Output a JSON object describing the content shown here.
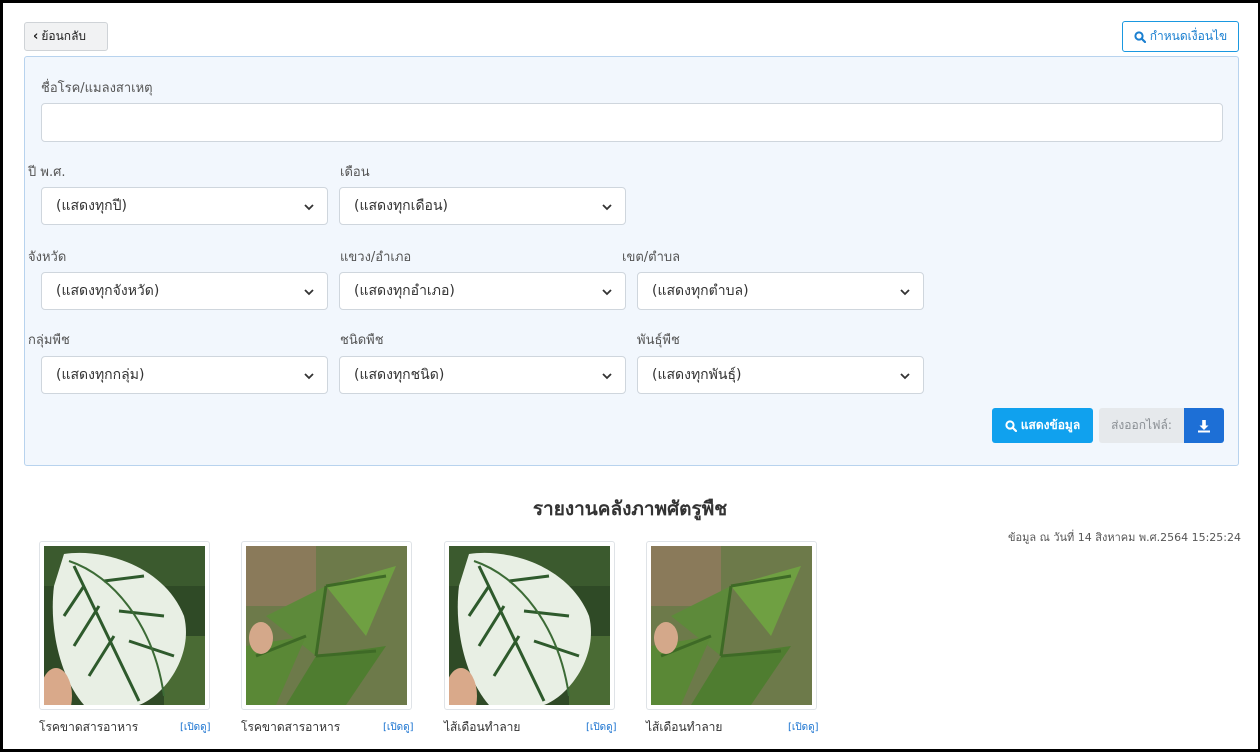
{
  "back_button": {
    "label": "ย้อนกลับ"
  },
  "condition_button": {
    "label": "กำหนดเงื่อนไข"
  },
  "filters": {
    "disease_label": "ชื่อโรค/แมลงสาเหตุ",
    "disease_value": "",
    "year": {
      "label": "ปี พ.ศ.",
      "value": "(แสดงทุกปี)"
    },
    "month": {
      "label": "เดือน",
      "value": "(แสดงทุกเดือน)"
    },
    "province": {
      "label": "จังหวัด",
      "value": "(แสดงทุกจังหวัด)"
    },
    "district": {
      "label": "แขวง/อำเภอ",
      "value": "(แสดงทุกอำเภอ)"
    },
    "subdistrict": {
      "label": "เขต/ตำบล",
      "value": "(แสดงทุกตำบล)"
    },
    "plant_group": {
      "label": "กลุ่มพืช",
      "value": "(แสดงทุกกลุ่ม)"
    },
    "plant_type": {
      "label": "ชนิดพืช",
      "value": "(แสดงทุกชนิด)"
    },
    "plant_variety": {
      "label": "พันธุ์พืช",
      "value": "(แสดงทุกพันธุ์)"
    }
  },
  "actions": {
    "show_label": "แสดงข้อมูล",
    "export_label": "ส่งออกไฟล์:"
  },
  "report": {
    "title": "รายงานคลังภาพศัตรูพืช",
    "data_date": "ข้อมูล ณ วันที่ 14 สิงหาคม พ.ศ.2564 15:25:24"
  },
  "gallery": [
    {
      "name": "โรคขาดสารอาหาร",
      "link": "[เปิดดู]",
      "image": "caladium-leaf"
    },
    {
      "name": "โรคขาดสารอาหาร",
      "link": "[เปิดดู]",
      "image": "cassava-leaf"
    },
    {
      "name": "ไส้เดือนทำลาย",
      "link": "[เปิดดู]",
      "image": "caladium-leaf"
    },
    {
      "name": "ไส้เดือนทำลาย",
      "link": "[เปิดดู]",
      "image": "cassava-leaf"
    }
  ],
  "colors": {
    "accent": "#10a1ee",
    "download": "#1d6fd6",
    "panel_bg": "#f2f7fd",
    "link": "#1a73d0"
  }
}
